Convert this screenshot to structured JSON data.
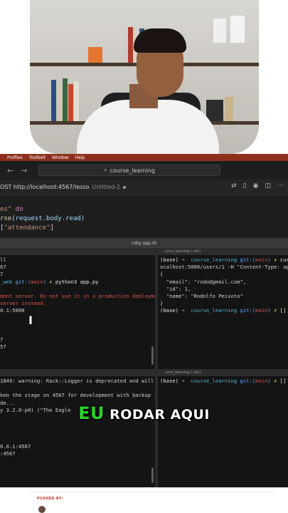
{
  "menubar": {
    "items": [
      "Profiles",
      "Toolbelt",
      "Window",
      "Help"
    ]
  },
  "nav": {
    "back": "←",
    "forward": "→",
    "search_icon": "⌕",
    "search_text": "course_learning"
  },
  "tabs": {
    "active_label": "OST http://localhost:4567/lesso",
    "untitled_label": "Untitled-2"
  },
  "code": {
    "line1_a": "es\"",
    "line1_b": " do",
    "line2_a": "rse",
    "line2_b": "(request.body.read)",
    "line3_a": "[",
    "line3_b": "\"attendance\"",
    "line3_c": "]"
  },
  "terminal": {
    "window_title": "ruby app.rb",
    "right_pane_title": "...urse_learning (-zsh)",
    "right_bottom_pane_title": "...urse_learning (-zsh)",
    "tl": {
      "l1": "ll",
      "l2": "67",
      "l3": "7",
      "l4a": "_web",
      "l4b": " git:(",
      "l4c": "main",
      "l4d": ") ",
      "l4e": "✗",
      "l4f": " python3 app.py",
      "l5": "ment server. Do not use it in a production deployme",
      "l6": "server instead.",
      "l7": "0.1:5000",
      "l8": "7",
      "l9": "57"
    },
    "tr": {
      "l1a": "(base) ",
      "l1b": "➜",
      "l1c": "  course_learning",
      "l1d": " git:(",
      "l1e": "main",
      "l1f": ") ",
      "l1g": "✗",
      "l1h": " curl",
      "l2": "ocalhost:5000/users/1 -H \"Content-Type: app",
      "l3": "{",
      "l4": "  \"email\": \"rodo@gmail.com\",",
      "l5": "  \"id\": 1,",
      "l6": "  \"name\": \"Rodolfo Peixoto\"",
      "l7": "}",
      "l8a": "(base) ",
      "l8b": "➜",
      "l8c": "  course_learning",
      "l8d": " git:(",
      "l8e": "main",
      "l8f": ") ",
      "l8g": "✗",
      "l8h": " []"
    },
    "bl": {
      "l1": "1849: warning: Rack::Logger is deprecated and will",
      "l2": "",
      "l3": "ken the stage on 4567 for development with backup f",
      "l4": "de...",
      "l5": "y 3.2.0-p0) (\"The Eagle",
      "l6": "",
      "l7": "",
      "l8": "0.0.1:4567",
      "l9": ":4567"
    },
    "br": {
      "l1a": "(base) ",
      "l1b": "➜",
      "l1c": "  course_learning",
      "l1d": " git:(",
      "l1e": "main",
      "l1f": ") ",
      "l1g": "✗",
      "l1h": " []"
    }
  },
  "caption": {
    "highlight": "EU",
    "rest": " RODAR AQUI"
  },
  "footer": {
    "pushed_by": "PUSHED BY:"
  },
  "colors": {
    "menubar": "#8e2f1d",
    "caption_highlight": "#2ad12a",
    "prompt_cyan": "#4fb4d8",
    "prompt_green": "#4fc14f",
    "error_red": "#d9534f"
  }
}
